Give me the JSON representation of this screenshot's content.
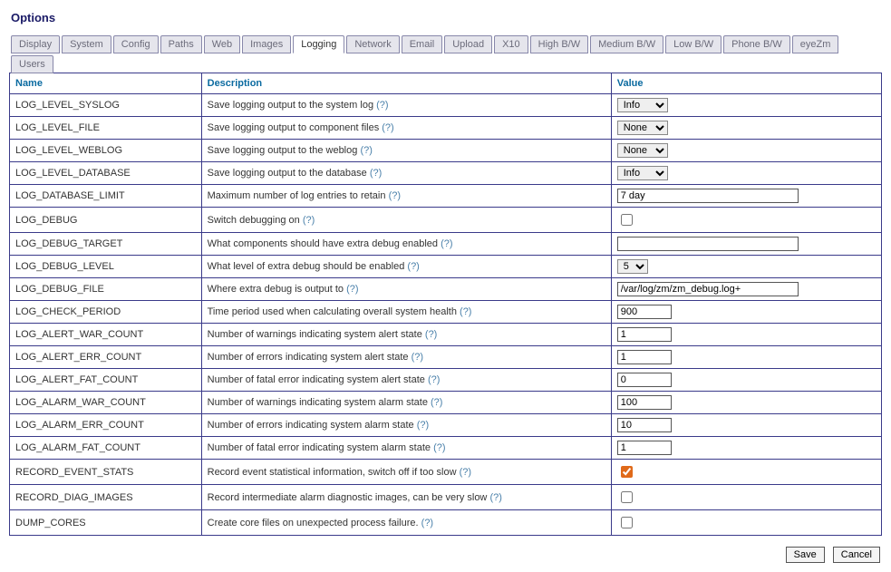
{
  "title": "Options",
  "tabs": [
    {
      "label": "Display",
      "active": false
    },
    {
      "label": "System",
      "active": false
    },
    {
      "label": "Config",
      "active": false
    },
    {
      "label": "Paths",
      "active": false
    },
    {
      "label": "Web",
      "active": false
    },
    {
      "label": "Images",
      "active": false
    },
    {
      "label": "Logging",
      "active": true
    },
    {
      "label": "Network",
      "active": false
    },
    {
      "label": "Email",
      "active": false
    },
    {
      "label": "Upload",
      "active": false
    },
    {
      "label": "X10",
      "active": false
    },
    {
      "label": "High B/W",
      "active": false
    },
    {
      "label": "Medium B/W",
      "active": false
    },
    {
      "label": "Low B/W",
      "active": false
    },
    {
      "label": "Phone B/W",
      "active": false
    },
    {
      "label": "eyeZm",
      "active": false
    },
    {
      "label": "Users",
      "active": false
    }
  ],
  "columns": {
    "name": "Name",
    "description": "Description",
    "value": "Value"
  },
  "help_marker": "(?)",
  "rows": [
    {
      "name": "LOG_LEVEL_SYSLOG",
      "desc": "Save logging output to the system log",
      "type": "select",
      "value": "Info"
    },
    {
      "name": "LOG_LEVEL_FILE",
      "desc": "Save logging output to component files",
      "type": "select",
      "value": "None"
    },
    {
      "name": "LOG_LEVEL_WEBLOG",
      "desc": "Save logging output to the weblog",
      "type": "select",
      "value": "None"
    },
    {
      "name": "LOG_LEVEL_DATABASE",
      "desc": "Save logging output to the database",
      "type": "select",
      "value": "Info"
    },
    {
      "name": "LOG_DATABASE_LIMIT",
      "desc": "Maximum number of log entries to retain",
      "type": "text",
      "value": "7 day"
    },
    {
      "name": "LOG_DEBUG",
      "desc": "Switch debugging on",
      "type": "checkbox",
      "value": false
    },
    {
      "name": "LOG_DEBUG_TARGET",
      "desc": "What components should have extra debug enabled",
      "type": "text",
      "value": ""
    },
    {
      "name": "LOG_DEBUG_LEVEL",
      "desc": "What level of extra debug should be enabled",
      "type": "select_small",
      "value": "5"
    },
    {
      "name": "LOG_DEBUG_FILE",
      "desc": "Where extra debug is output to",
      "type": "text",
      "value": "/var/log/zm/zm_debug.log+"
    },
    {
      "name": "LOG_CHECK_PERIOD",
      "desc": "Time period used when calculating overall system health",
      "type": "text_short",
      "value": "900"
    },
    {
      "name": "LOG_ALERT_WAR_COUNT",
      "desc": "Number of warnings indicating system alert state",
      "type": "text_short",
      "value": "1"
    },
    {
      "name": "LOG_ALERT_ERR_COUNT",
      "desc": "Number of errors indicating system alert state",
      "type": "text_short",
      "value": "1"
    },
    {
      "name": "LOG_ALERT_FAT_COUNT",
      "desc": "Number of fatal error indicating system alert state",
      "type": "text_short",
      "value": "0"
    },
    {
      "name": "LOG_ALARM_WAR_COUNT",
      "desc": "Number of warnings indicating system alarm state",
      "type": "text_short",
      "value": "100"
    },
    {
      "name": "LOG_ALARM_ERR_COUNT",
      "desc": "Number of errors indicating system alarm state",
      "type": "text_short",
      "value": "10"
    },
    {
      "name": "LOG_ALARM_FAT_COUNT",
      "desc": "Number of fatal error indicating system alarm state",
      "type": "text_short",
      "value": "1"
    },
    {
      "name": "RECORD_EVENT_STATS",
      "desc": "Record event statistical information, switch off if too slow",
      "type": "checkbox",
      "value": true
    },
    {
      "name": "RECORD_DIAG_IMAGES",
      "desc": "Record intermediate alarm diagnostic images, can be very slow",
      "type": "checkbox",
      "value": false
    },
    {
      "name": "DUMP_CORES",
      "desc": "Create core files on unexpected process failure.",
      "type": "checkbox",
      "value": false
    }
  ],
  "buttons": {
    "save": "Save",
    "cancel": "Cancel"
  }
}
